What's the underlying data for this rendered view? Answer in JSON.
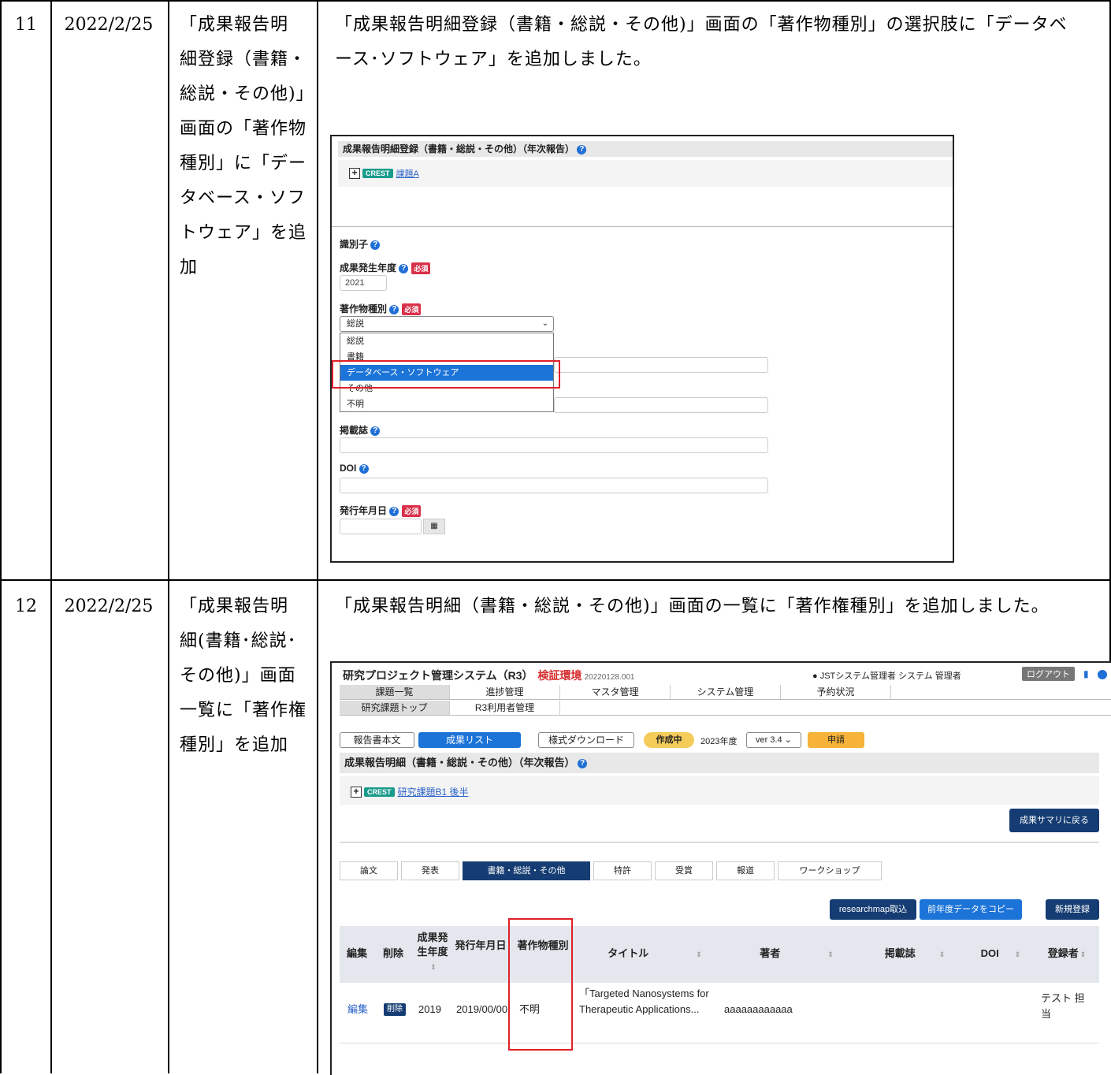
{
  "rows": [
    {
      "no": "11",
      "date": "2022/2/25",
      "title_lines": [
        "「成果報告明",
        "細登録（書籍・",
        "総説・その他)」",
        "画面の「著作物",
        "種別」に「デー",
        "タベース・ソフ",
        "トウェア」を追",
        "加"
      ],
      "desc_lines": [
        "「成果報告明細登録（書籍・総説・その他)」画面の「著作物種別」の選択肢に「データベ",
        "ース･ソフトウェア」を追加しました。"
      ]
    },
    {
      "no": "12",
      "date": "2022/2/25",
      "title_lines": [
        "「成果報告明",
        "細(書籍･総説･",
        "その他)」画面",
        "一覧に「著作権",
        "種別」を追加"
      ],
      "desc_lines": [
        "「成果報告明細（書籍・総説・その他)」画面の一覧に「著作権種別」を追加しました。"
      ]
    }
  ],
  "shot1": {
    "header": "成果報告明細登録（書籍・総説・その他）（年次報告）",
    "crest": "CREST",
    "project_link": "課題A",
    "identifier_label": "識別子",
    "year_label": "成果発生年度",
    "required": "必須",
    "year_value": "2021",
    "type_label": "著作物種別",
    "type_selected": "総説",
    "type_options": [
      "総説",
      "書籍",
      "データベース・ソフトウェア",
      "その他",
      "不明"
    ],
    "journal_label": "掲載誌",
    "doi_label": "DOI",
    "pubdate_label": "発行年月日"
  },
  "shot2": {
    "app_title": "研究プロジェクト管理システム（R3）",
    "env": "検証環境",
    "version": "20220128.001",
    "user": "JSTシステム管理者 システム 管理者",
    "logout": "ログアウト",
    "nav1": [
      "課題一覧",
      "進捗管理",
      "マスタ管理",
      "システム管理",
      "予約状況"
    ],
    "nav2": [
      "研究課題トップ",
      "R3利用者管理"
    ],
    "btn_report": "報告書本文",
    "btn_results": "成果リスト",
    "btn_download": "様式ダウンロード",
    "status": "作成中",
    "fiscal_year": "2023年度",
    "ver_select": "ver 3.4",
    "apply": "申請",
    "header": "成果報告明細（書籍・総説・その他）（年次報告）",
    "crest": "CREST",
    "project_link": "研究課題B1 後半",
    "back_btn": "成果サマリに戻る",
    "tabs": [
      "論文",
      "発表",
      "書籍・総説・その他",
      "特許",
      "受賞",
      "報道",
      "ワークショップ"
    ],
    "btn_researchmap": "researchmap取込",
    "btn_copy": "前年度データをコピー",
    "btn_new": "新規登録",
    "columns": [
      "編集",
      "削除",
      "成果発生年度",
      "発行年月日",
      "著作物種別",
      "タイトル",
      "著者",
      "掲載誌",
      "DOI",
      "登録者"
    ],
    "row": {
      "edit": "編集",
      "delete": "削除",
      "year": "2019",
      "pubdate": "2019/00/00",
      "type": "不明",
      "title": "「Targeted Nanosystems for Therapeutic Applications...",
      "author": "aaaaaaaaaaaa",
      "journal": "",
      "doi": "",
      "registrant": "テスト 担当"
    }
  }
}
